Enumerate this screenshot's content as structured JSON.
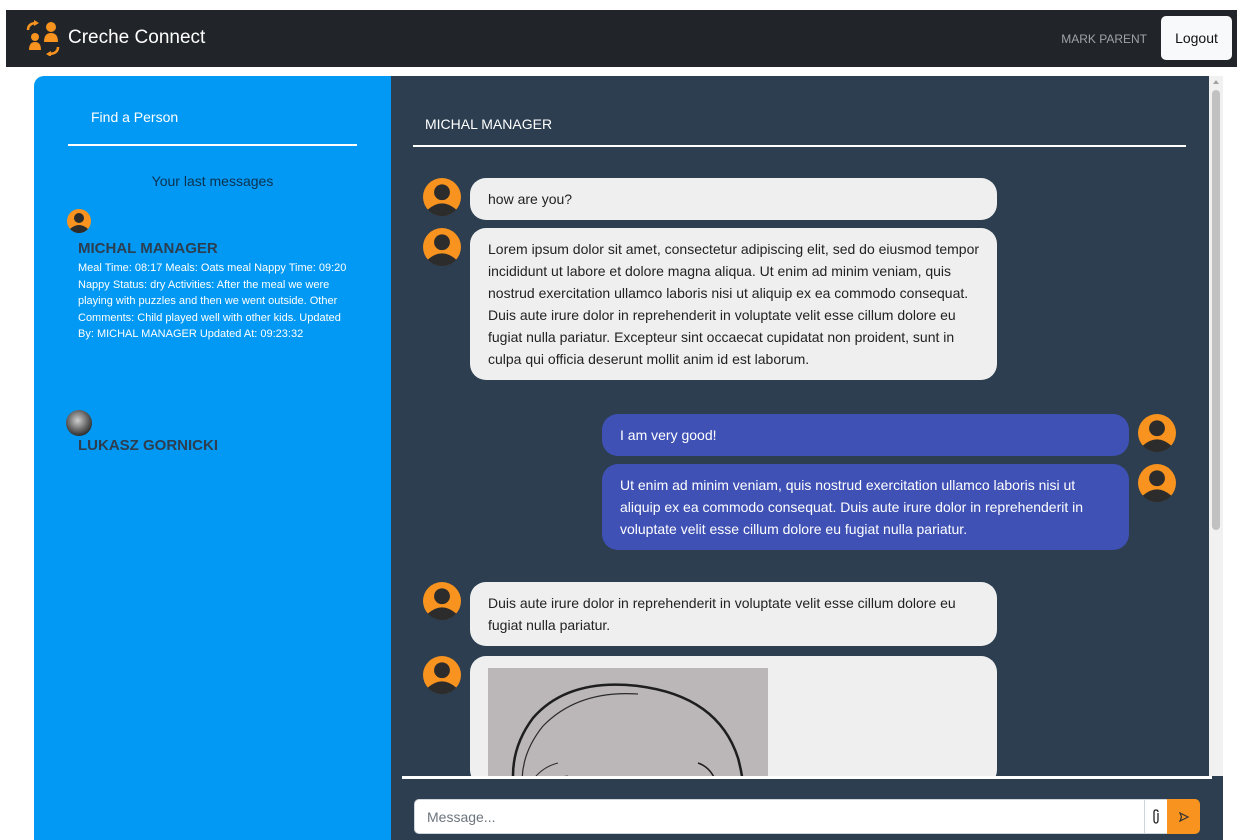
{
  "app": {
    "brand": "Creche Connect",
    "user_name": "MARK PARENT",
    "logout_label": "Logout"
  },
  "sidebar": {
    "find_person": "Find a Person",
    "last_messages_title": "Your last messages",
    "contacts": [
      {
        "name": "MICHAL MANAGER",
        "avatar_icon": "user-avatar-icon",
        "preview": "Meal Time: 08:17 Meals: Oats meal Nappy Time: 09:20 Nappy Status: dry Activities: After the meal we were playing with puzzles and then we went outside. Other Comments: Child played well with other kids. Updated By: MICHAL MANAGER Updated At: 09:23:32"
      },
      {
        "name": "LUKASZ GORNICKI",
        "avatar_icon": "photo-avatar",
        "preview": ""
      }
    ]
  },
  "chat": {
    "header": "MICHAL MANAGER",
    "messages": [
      {
        "direction": "in",
        "text": "how are you?"
      },
      {
        "direction": "in",
        "text": "Lorem ipsum dolor sit amet, consectetur adipiscing elit, sed do eiusmod tempor incididunt ut labore et dolore magna aliqua. Ut enim ad minim veniam, quis nostrud exercitation ullamco laboris nisi ut aliquip ex ea commodo consequat. Duis aute irure dolor in reprehenderit in voluptate velit esse cillum dolore eu fugiat nulla pariatur. Excepteur sint occaecat cupidatat non proident, sunt in culpa qui officia deserunt mollit anim id est laborum."
      },
      {
        "direction": "out",
        "text": "I am very good!"
      },
      {
        "direction": "out",
        "text": "Ut enim ad minim veniam, quis nostrud exercitation ullamco laboris nisi ut aliquip ex ea commodo consequat. Duis aute irure dolor in reprehenderit in voluptate velit esse cillum dolore eu fugiat nulla pariatur."
      },
      {
        "direction": "in",
        "text": "Duis aute irure dolor in reprehenderit in voluptate velit esse cillum dolore eu fugiat nulla pariatur."
      },
      {
        "direction": "in",
        "type": "image",
        "text": ""
      }
    ],
    "composer": {
      "placeholder": "Message...",
      "attach_icon": "paperclip-icon",
      "send_icon": "send-icon"
    }
  },
  "colors": {
    "topbar": "#212529",
    "sidebar": "#0199f4",
    "chat_bg": "#2c3e50",
    "incoming_bubble": "#efefef",
    "outgoing_bubble": "#3f51b5",
    "accent": "#f7931e"
  }
}
